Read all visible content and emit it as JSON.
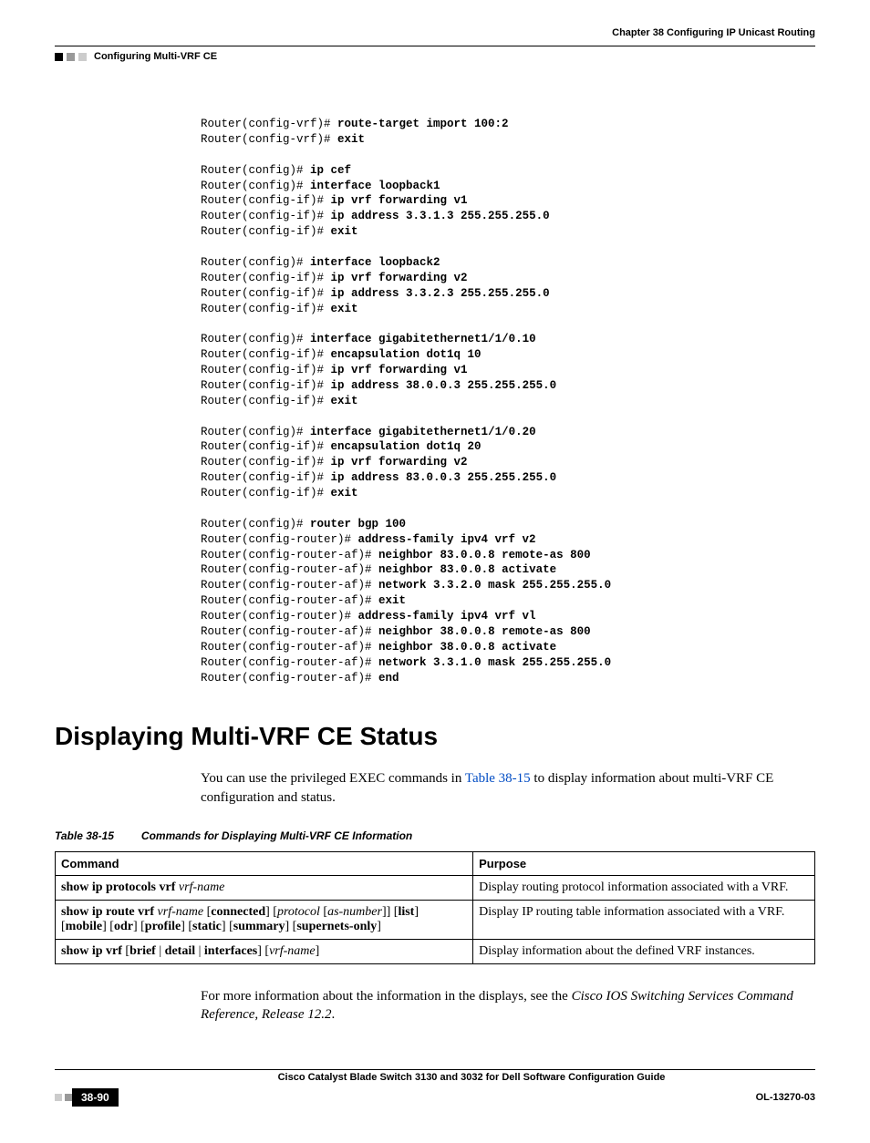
{
  "header": {
    "chapter": "Chapter 38    Configuring IP Unicast Routing",
    "section": "Configuring Multi-VRF CE"
  },
  "code": {
    "l1": {
      "p": "Router(config-vrf)# ",
      "c": "route-target import 100:2"
    },
    "l2": {
      "p": "Router(config-vrf)# ",
      "c": "exit"
    },
    "l3": {
      "p": "Router(config)# ",
      "c": "ip cef"
    },
    "l4": {
      "p": "Router(config)# ",
      "c": "interface loopback1"
    },
    "l5": {
      "p": "Router(config-if)# ",
      "c": "ip vrf forwarding v1"
    },
    "l6": {
      "p": "Router(config-if)# ",
      "c": "ip address 3.3.1.3 255.255.255.0"
    },
    "l7": {
      "p": "Router(config-if)# ",
      "c": "exit"
    },
    "l8": {
      "p": "Router(config)# ",
      "c": "interface loopback2"
    },
    "l9": {
      "p": "Router(config-if)# ",
      "c": "ip vrf forwarding v2"
    },
    "l10": {
      "p": "Router(config-if)# ",
      "c": "ip address 3.3.2.3 255.255.255.0"
    },
    "l11": {
      "p": "Router(config-if)# ",
      "c": "exit"
    },
    "l12": {
      "p": "Router(config)# ",
      "c": "interface gigabitethernet1/1/0.10"
    },
    "l13": {
      "p": "Router(config-if)# ",
      "c": "encapsulation dot1q 10"
    },
    "l14": {
      "p": "Router(config-if)# ",
      "c": "ip vrf forwarding v1"
    },
    "l15": {
      "p": "Router(config-if)# ",
      "c": "ip address 38.0.0.3 255.255.255.0"
    },
    "l16": {
      "p": "Router(config-if)# ",
      "c": "exit"
    },
    "l17": {
      "p": "Router(config)# ",
      "c": "interface gigabitethernet1/1/0.20"
    },
    "l18": {
      "p": "Router(config-if)# ",
      "c": "encapsulation dot1q 20"
    },
    "l19": {
      "p": "Router(config-if)# ",
      "c": "ip vrf forwarding v2"
    },
    "l20": {
      "p": "Router(config-if)# ",
      "c": "ip address 83.0.0.3 255.255.255.0"
    },
    "l21": {
      "p": "Router(config-if)# ",
      "c": "exit"
    },
    "l22": {
      "p": "Router(config)# ",
      "c": "router bgp 100"
    },
    "l23": {
      "p": "Router(config-router)# ",
      "c": "address-family ipv4 vrf v2"
    },
    "l24": {
      "p": "Router(config-router-af)# ",
      "c": "neighbor 83.0.0.8 remote-as 800"
    },
    "l25": {
      "p": "Router(config-router-af)# ",
      "c": "neighbor 83.0.0.8 activate"
    },
    "l26": {
      "p": "Router(config-router-af)# ",
      "c": "network 3.3.2.0 mask 255.255.255.0"
    },
    "l27": {
      "p": "Router(config-router-af)# ",
      "c": "exit"
    },
    "l28": {
      "p": "Router(config-router)# ",
      "c": "address-family ipv4 vrf vl"
    },
    "l29": {
      "p": "Router(config-router-af)# ",
      "c": "neighbor 38.0.0.8 remote-as 800"
    },
    "l30": {
      "p": "Router(config-router-af)# ",
      "c": "neighbor 38.0.0.8 activate"
    },
    "l31": {
      "p": "Router(config-router-af)# ",
      "c": "network 3.3.1.0 mask 255.255.255.0"
    },
    "l32": {
      "p": "Router(config-router-af)# ",
      "c": "end"
    }
  },
  "heading": "Displaying Multi-VRF CE Status",
  "intro1": "You can use the privileged EXEC commands in ",
  "introXref": "Table 38-15",
  "intro2": " to display information about multi-VRF CE configuration and status.",
  "tableCaptionNum": "Table 38-15",
  "tableCaption": "Commands for Displaying Multi-VRF CE Information",
  "th1": "Command",
  "th2": "Purpose",
  "row1": {
    "cmd_b1": "show ip protocols vrf ",
    "cmd_i1": "vrf-name",
    "purpose": "Display routing protocol information associated with a VRF."
  },
  "row2": {
    "cmd_b1": "show ip route vrf ",
    "cmd_i1": "vrf-name ",
    "cmd_p1": "[",
    "cmd_b2": "connected",
    "cmd_p2": "] [",
    "cmd_i2": "protocol ",
    "cmd_p3": "[",
    "cmd_i3": "as-number",
    "cmd_p4": "]] [",
    "cmd_b3": "list",
    "cmd_p5": "] [",
    "cmd_b4": "mobile",
    "cmd_p6": "] [",
    "cmd_b5": "odr",
    "cmd_p7": "] [",
    "cmd_b6": "profile",
    "cmd_p8": "] [",
    "cmd_b7": "static",
    "cmd_p9": "] [",
    "cmd_b8": "summary",
    "cmd_p10": "] [",
    "cmd_b9": "supernets-only",
    "cmd_p11": "]",
    "purpose": "Display IP routing table information associated with a VRF."
  },
  "row3": {
    "cmd_b1": "show ip vrf ",
    "cmd_p1": "[",
    "cmd_b2": "brief ",
    "cmd_p2": "| ",
    "cmd_b3": "detail ",
    "cmd_p3": "| ",
    "cmd_b4": "interfaces",
    "cmd_p4": "] [",
    "cmd_i1": "vrf-name",
    "cmd_p5": "]",
    "purpose": "Display information about the defined VRF instances."
  },
  "outro1": "For more information about the information in the displays, see the ",
  "outroItal": "Cisco IOS Switching Services Command Reference, Release 12.2",
  "outro2": ".",
  "footerTitle": "Cisco Catalyst Blade Switch 3130 and 3032 for Dell Software Configuration Guide",
  "pageNum": "38-90",
  "docId": "OL-13270-03"
}
